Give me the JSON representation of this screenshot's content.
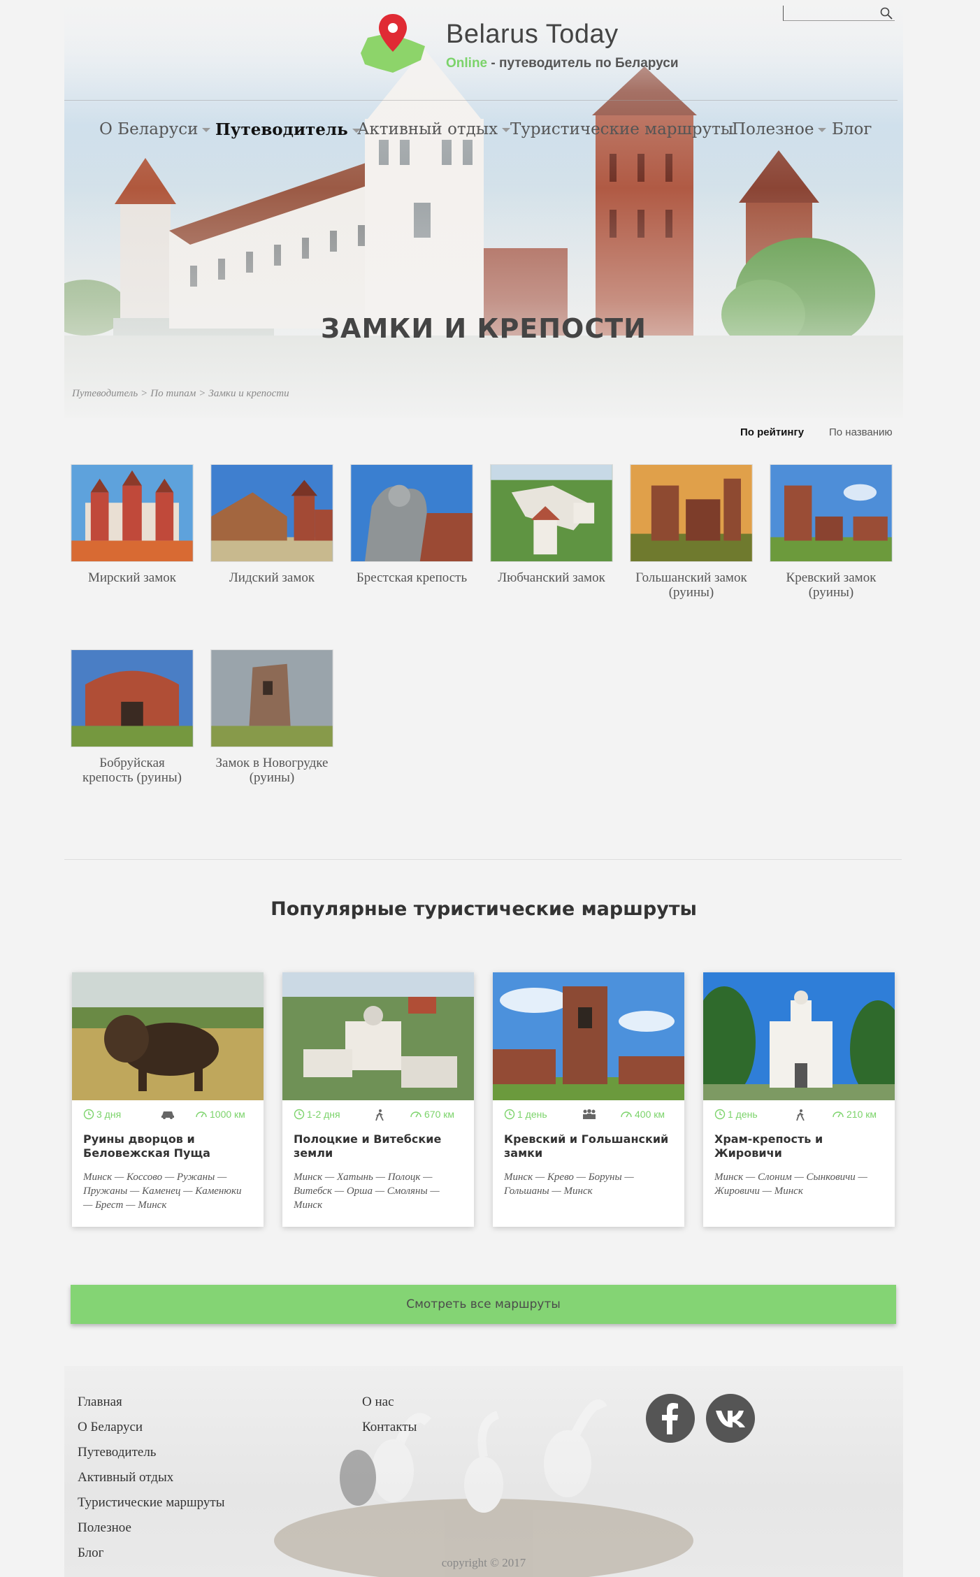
{
  "search": {
    "placeholder": ""
  },
  "brand": {
    "title": "Belarus Today",
    "online": "Online",
    "tagline_rest": " - путеводитель по Беларуси",
    "accent": "#7bd36a"
  },
  "nav": [
    {
      "label": "О Беларуси",
      "dropdown": true,
      "active": false
    },
    {
      "label": "Путеводитель",
      "dropdown": true,
      "active": true
    },
    {
      "label": "Активный отдых",
      "dropdown": true,
      "active": false
    },
    {
      "label": "Туристические маршруты",
      "dropdown": false,
      "active": false
    },
    {
      "label": "Полезное",
      "dropdown": true,
      "active": false
    },
    {
      "label": "Блог",
      "dropdown": false,
      "active": false
    }
  ],
  "page_title": "ЗАМКИ И КРЕПОСТИ",
  "breadcrumb": [
    "Путеводитель",
    ">",
    "По типам",
    ">",
    "Замки и крепости"
  ],
  "sort": {
    "by_rating": "По рейтингу",
    "by_name": "По названию"
  },
  "places": [
    {
      "label": "Мирский замок"
    },
    {
      "label": "Лидский замок"
    },
    {
      "label": "Брестская крепость"
    },
    {
      "label": "Любчанский замок"
    },
    {
      "label": "Гольшанский замок (руины)"
    },
    {
      "label": "Кревский замок (руины)"
    },
    {
      "label": "Бобруйская крепость (руины)"
    },
    {
      "label": "Замок в Новогрудке (руины)"
    }
  ],
  "routes_title": "Популярные туристические маршруты",
  "routes": [
    {
      "duration": "3 дня",
      "transport": "car-icon",
      "distance": "1000 км",
      "title": "Руины дворцов и Беловежская Пуща",
      "path": "Минск — Коссово — Ружаны — Пружаны — Каменец — Каменюки — Брест — Минск"
    },
    {
      "duration": "1-2 дня",
      "transport": "walking-icon",
      "distance": "670 км",
      "title": "Полоцкие и Витебские земли",
      "path": "Минск — Хатынь — Полоцк — Витебск — Орша — Смоляны — Минск"
    },
    {
      "duration": "1 день",
      "transport": "group-icon",
      "distance": "400 км",
      "title": "Кревский и Гольшанский замки",
      "path": "Минск — Крево — Боруны — Гольшаны — Минск"
    },
    {
      "duration": "1 день",
      "transport": "walking-icon",
      "distance": "210 км",
      "title": "Храм-крепость и Жировичи",
      "path": "Минск — Слоним — Сынковичи — Жировичи — Минск"
    }
  ],
  "cta": "Смотреть все маршруты",
  "footer": {
    "col1": [
      "Главная",
      "О Беларуси",
      "Путеводитель",
      "Активный отдых",
      "Туристические маршруты",
      "Полезное",
      "Блог"
    ],
    "col2": [
      "О нас",
      "Контакты"
    ],
    "social": [
      "facebook-icon",
      "vk-icon"
    ],
    "copyright": "copyright © 2017"
  }
}
